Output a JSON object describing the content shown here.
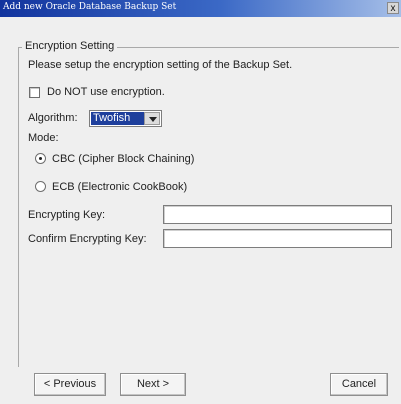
{
  "window": {
    "title": "Add new Oracle Database Backup Set",
    "close_glyph": "x"
  },
  "group": {
    "legend": "Encryption Setting",
    "description": "Please setup the encryption setting of the Backup Set."
  },
  "no_encryption": {
    "label": "Do NOT use encryption.",
    "checked": false
  },
  "algorithm": {
    "label": "Algorithm:",
    "value": "Twofish"
  },
  "mode": {
    "label": "Mode:",
    "options": [
      {
        "label": "CBC (Cipher Block Chaining)",
        "selected": true
      },
      {
        "label": "ECB (Electronic CookBook)",
        "selected": false
      }
    ]
  },
  "fields": {
    "key_label": "Encrypting Key:",
    "key_value": "",
    "confirm_label": "Confirm Encrypting Key:",
    "confirm_value": ""
  },
  "buttons": {
    "previous": "< Previous",
    "next": "Next >",
    "cancel": "Cancel"
  }
}
